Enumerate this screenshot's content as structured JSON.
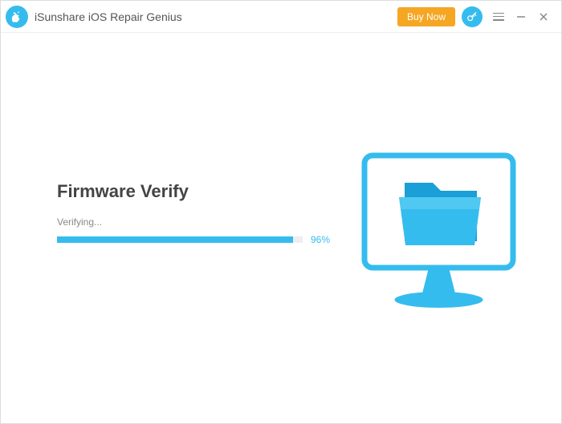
{
  "app": {
    "title": "iSunshare iOS Repair Genius"
  },
  "titlebar": {
    "buy_label": "Buy Now"
  },
  "main": {
    "heading": "Firmware Verify",
    "status": "Verifying...",
    "progress_pct_label": "96%",
    "progress_pct_value": 96
  },
  "icons": {
    "app": "wrench-apple-icon",
    "key": "key-icon",
    "monitor": "monitor-folder-icon"
  },
  "colors": {
    "accent": "#35bcee",
    "buy": "#f5a623"
  }
}
